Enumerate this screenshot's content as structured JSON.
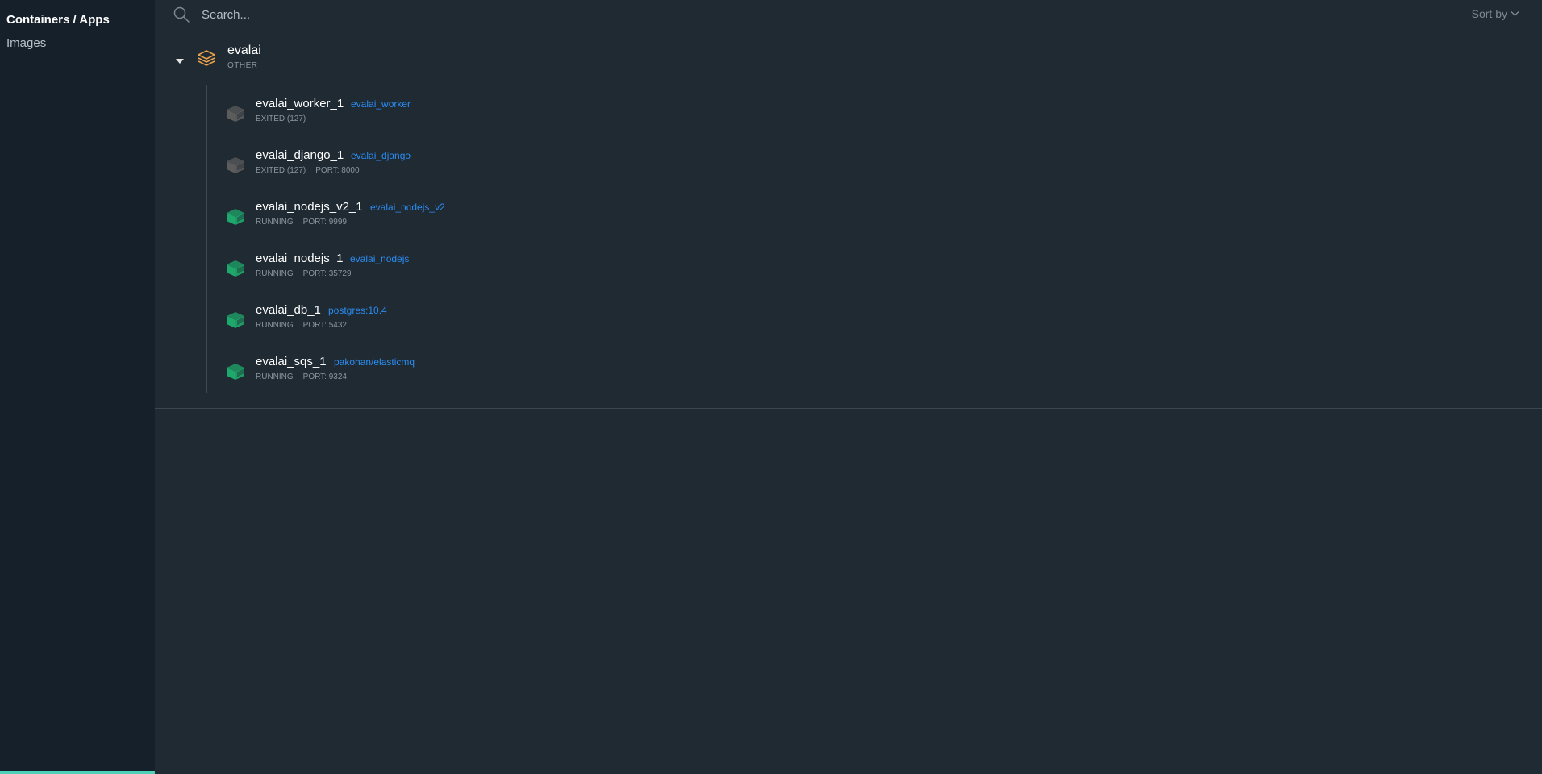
{
  "sidebar": {
    "items": [
      {
        "label": "Containers / Apps"
      },
      {
        "label": "Images"
      }
    ]
  },
  "search": {
    "placeholder": "Search..."
  },
  "sort": {
    "label": "Sort by"
  },
  "group": {
    "name": "evalai",
    "type": "OTHER",
    "containers": [
      {
        "name": "evalai_worker_1",
        "image": "evalai_worker",
        "status": "EXITED (127)",
        "port": "",
        "state": "exited"
      },
      {
        "name": "evalai_django_1",
        "image": "evalai_django",
        "status": "EXITED (127)",
        "port": "PORT: 8000",
        "state": "exited"
      },
      {
        "name": "evalai_nodejs_v2_1",
        "image": "evalai_nodejs_v2",
        "status": "RUNNING",
        "port": "PORT: 9999",
        "state": "running"
      },
      {
        "name": "evalai_nodejs_1",
        "image": "evalai_nodejs",
        "status": "RUNNING",
        "port": "PORT: 35729",
        "state": "running"
      },
      {
        "name": "evalai_db_1",
        "image": "postgres:10.4",
        "status": "RUNNING",
        "port": "PORT: 5432",
        "state": "running"
      },
      {
        "name": "evalai_sqs_1",
        "image": "pakohan/elasticmq",
        "status": "RUNNING",
        "port": "PORT: 9324",
        "state": "running"
      }
    ]
  },
  "colors": {
    "running": "#1fa86b",
    "exited": "#5c5c5c",
    "stack": "#e8a04c",
    "link": "#2b8cf0",
    "accent": "#4fd1b7"
  },
  "icons": {
    "search": "search-icon",
    "caret": "caret-down-icon",
    "stack": "stack-icon",
    "container": "container-icon"
  }
}
